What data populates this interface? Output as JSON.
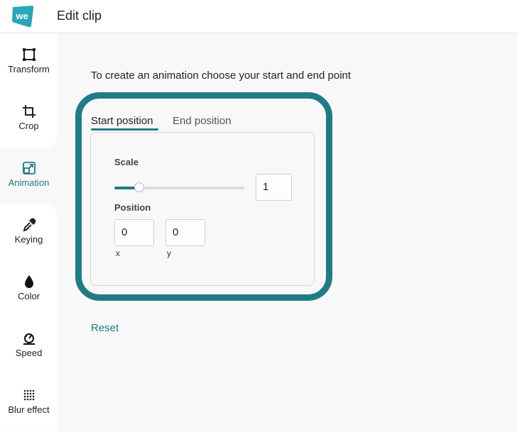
{
  "header": {
    "title": "Edit clip",
    "logo_text": "we",
    "logo_color": "#1f9fb0"
  },
  "sidebar": {
    "items": [
      {
        "label": "Transform",
        "icon": "transform-icon"
      },
      {
        "label": "Crop",
        "icon": "crop-icon"
      },
      {
        "label": "Animation",
        "icon": "animation-icon",
        "active": true
      },
      {
        "label": "Keying",
        "icon": "eyedropper-icon"
      },
      {
        "label": "Color",
        "icon": "droplet-icon"
      },
      {
        "label": "Speed",
        "icon": "speedometer-icon"
      },
      {
        "label": "Blur effect",
        "icon": "blur-dots-icon"
      }
    ]
  },
  "main": {
    "instruction": "To create an animation choose your start and end point",
    "tabs": [
      {
        "label": "Start position",
        "active": true
      },
      {
        "label": "End position",
        "active": false
      }
    ],
    "scale": {
      "label": "Scale",
      "value": "1",
      "slider_fraction": 0.19
    },
    "position": {
      "label": "Position",
      "x": "0",
      "y": "0",
      "x_label": "x",
      "y_label": "y"
    },
    "reset_label": "Reset"
  },
  "colors": {
    "accent": "#1f7c87",
    "accent_text": "#1f7a85"
  }
}
